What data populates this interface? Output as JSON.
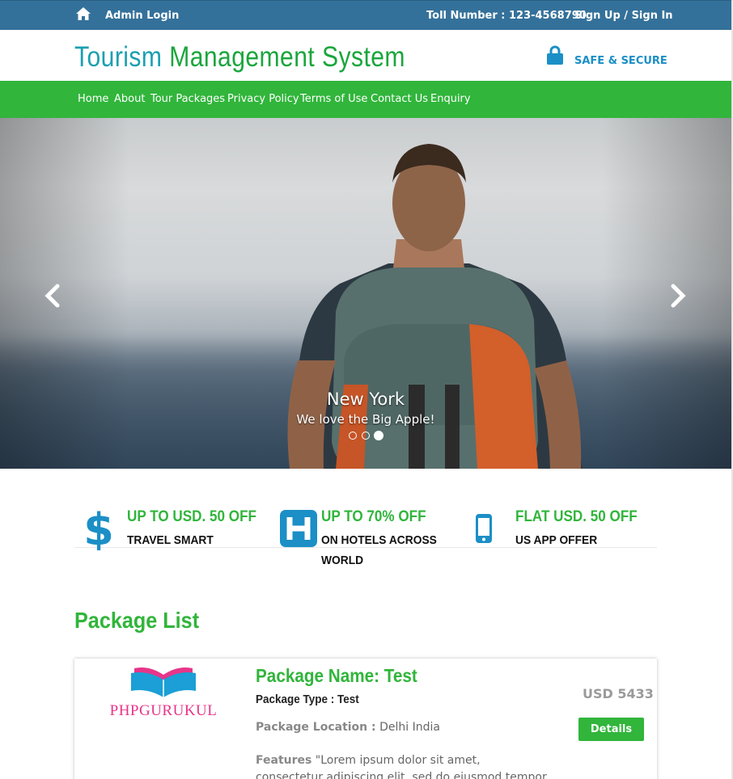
{
  "topbar": {
    "admin_login": "Admin Login",
    "toll_number": "Toll Number : 123-4568790",
    "signup_signin": "Sign Up / Sign In"
  },
  "header": {
    "brand_word1": "Tourism",
    "brand_word2": "Management System",
    "safe_secure": "SAFE & SECURE"
  },
  "nav": {
    "items": [
      {
        "label": "Home"
      },
      {
        "label": "About"
      },
      {
        "label": "Tour Packages"
      },
      {
        "label": "Privacy Policy"
      },
      {
        "label": "Terms of Use"
      },
      {
        "label": "Contact Us"
      },
      {
        "label": "Enquiry"
      }
    ]
  },
  "hero": {
    "caption_title": "New York",
    "caption_sub": "We love the Big Apple!",
    "slide_count": 3,
    "active_slide": 3
  },
  "offers": [
    {
      "icon": "dollar-icon",
      "headline": "UP TO USD. 50 OFF",
      "sub": "TRAVEL SMART"
    },
    {
      "icon": "hotel-icon",
      "headline": "UP TO 70% OFF",
      "sub": "ON HOTELS ACROSS WORLD"
    },
    {
      "icon": "mobile-icon",
      "headline": "FLAT USD. 50 OFF",
      "sub": "US APP OFFER"
    }
  ],
  "package_section": {
    "title": "Package List"
  },
  "package": {
    "logo_text": "PHPGURUKUL",
    "name": "Package Name: Test",
    "type": "Package Type : Test",
    "location_label": "Package Location :",
    "location_value": "Delhi India",
    "features_label": "Features",
    "features_value": "\"Lorem ipsum dolor sit amet, consectetur adipiscing elit, sed do eiusmod tempor incididunt ut",
    "price": "USD 5433",
    "details_label": "Details"
  },
  "colors": {
    "topbar": "#34719a",
    "nav": "#31b53b",
    "accent_green": "#31b53b",
    "accent_blue": "#1b8fc6"
  }
}
